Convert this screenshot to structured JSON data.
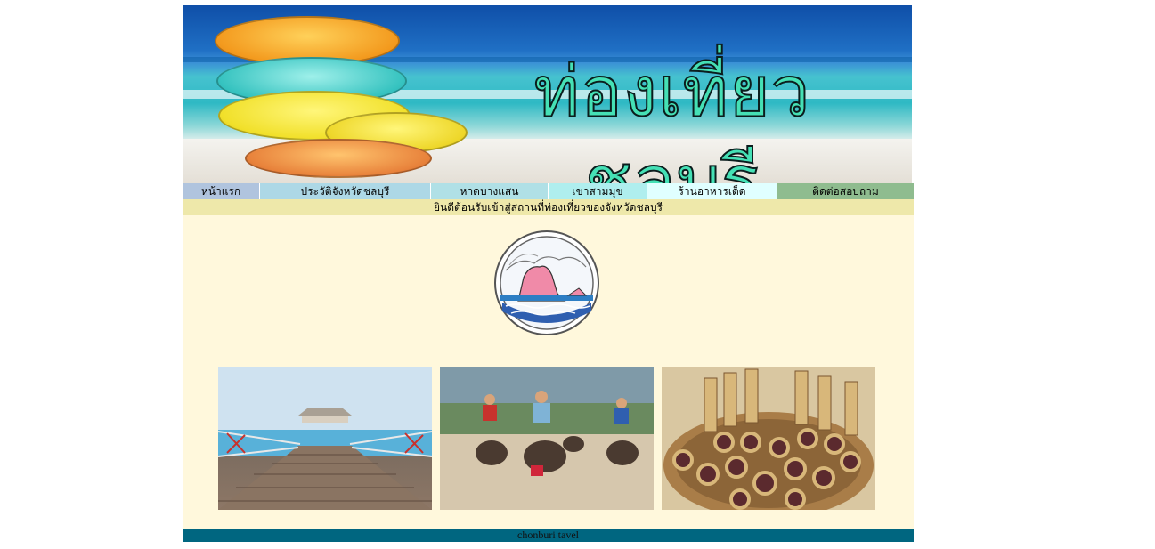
{
  "banner": {
    "title": "ท่องเที่ยวชลบุรี"
  },
  "nav": {
    "items": [
      {
        "label": "หน้าแรก"
      },
      {
        "label": "ประวัติจังหวัดชลบุรี"
      },
      {
        "label": "หาดบางแสน"
      },
      {
        "label": "เขาสามมุข"
      },
      {
        "label": "ร้านอาหารเด็ด"
      },
      {
        "label": "ติดต่อสอบถาม"
      }
    ]
  },
  "welcome": {
    "text": "ยินดีต้อนรับเข้าสู่สถานที่ท่องเที่ยวของจังหวัดชลบุรี"
  },
  "content": {
    "seal": {
      "icon": "chonburi-provincial-seal-icon"
    },
    "photos": [
      {
        "icon": "pier-photo"
      },
      {
        "icon": "buffalo-race-photo"
      },
      {
        "icon": "bamboo-sticky-rice-photo"
      }
    ]
  },
  "footer": {
    "text": "chonburi tavel"
  },
  "colors": {
    "nav_1": "#b0c4de",
    "nav_2": "#add8e6",
    "nav_3": "#b0e0e6",
    "nav_4": "#afeeee",
    "nav_5": "#e0ffff",
    "nav_6": "#8fbc8f",
    "welcome_bar": "#eee8aa",
    "content_bg": "#fff8dc",
    "footer_bg": "#006680"
  }
}
